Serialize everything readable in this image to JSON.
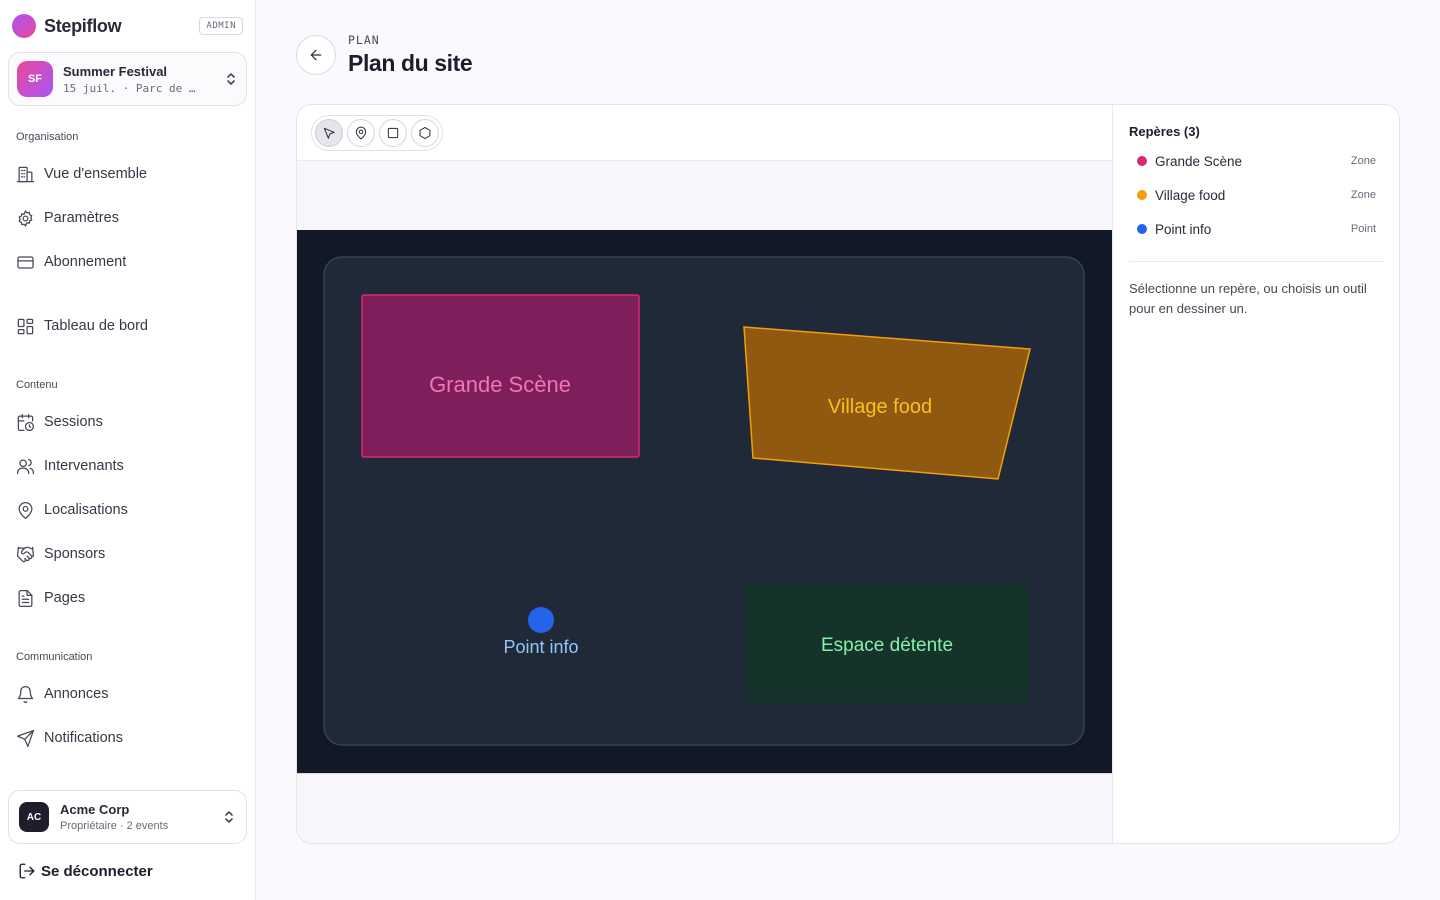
{
  "brand": {
    "name": "Stepiflow",
    "badge": "ADMIN"
  },
  "event_switcher": {
    "initials": "SF",
    "name": "Summer Festival",
    "meta": "15 juil. · Parc de …"
  },
  "nav": {
    "sections": [
      {
        "label": "Organisation"
      },
      {
        "label": "Contenu"
      },
      {
        "label": "Communication"
      }
    ],
    "items": [
      {
        "label": "Vue d'ensemble",
        "icon": "building-icon"
      },
      {
        "label": "Paramètres",
        "icon": "gear-icon"
      },
      {
        "label": "Abonnement",
        "icon": "credit-card-icon"
      },
      {
        "label": "Tableau de bord",
        "icon": "dashboard-icon"
      },
      {
        "label": "Sessions",
        "icon": "calendar-clock-icon"
      },
      {
        "label": "Intervenants",
        "icon": "users-icon"
      },
      {
        "label": "Localisations",
        "icon": "map-pin-icon"
      },
      {
        "label": "Sponsors",
        "icon": "handshake-icon"
      },
      {
        "label": "Pages",
        "icon": "document-icon"
      },
      {
        "label": "Annonces",
        "icon": "bell-icon"
      },
      {
        "label": "Notifications",
        "icon": "send-icon"
      }
    ]
  },
  "org_switcher": {
    "initials": "AC",
    "name": "Acme Corp",
    "meta": "Propriétaire · 2 events"
  },
  "logout": {
    "label": "Se déconnecter"
  },
  "header": {
    "kicker": "PLAN",
    "title": "Plan du site"
  },
  "toolbar": {
    "tools": [
      {
        "name": "select-tool",
        "icon": "cursor-icon",
        "active": true
      },
      {
        "name": "point-tool",
        "icon": "map-pin-icon",
        "active": false
      },
      {
        "name": "rectangle-tool",
        "icon": "square-icon",
        "active": false
      },
      {
        "name": "polygon-tool",
        "icon": "hexagon-icon",
        "active": false
      }
    ]
  },
  "map": {
    "zones": [
      {
        "label": "Grande Scène",
        "fill": "#7e1f5b",
        "stroke": "#db2777",
        "text_color": "#f472b6"
      },
      {
        "label": "Village food",
        "fill": "#8f5a0f",
        "stroke": "#f59e0b",
        "text_color": "#fbbf24"
      },
      {
        "label": "Espace détente",
        "fill": "#15332b",
        "stroke": "#15332b",
        "text_color": "#86efac"
      }
    ],
    "points": [
      {
        "label": "Point info",
        "fill": "#2563eb",
        "text_color": "#93c5fd"
      }
    ]
  },
  "panel": {
    "title": "Repères (3)",
    "markers": [
      {
        "name": "Grande Scène",
        "type": "Zone",
        "color": "#db2777"
      },
      {
        "name": "Village food",
        "type": "Zone",
        "color": "#f59e0b"
      },
      {
        "name": "Point info",
        "type": "Point",
        "color": "#2563eb"
      }
    ],
    "hint": "Sélectionne un repère, ou choisis un outil pour en dessiner un."
  }
}
